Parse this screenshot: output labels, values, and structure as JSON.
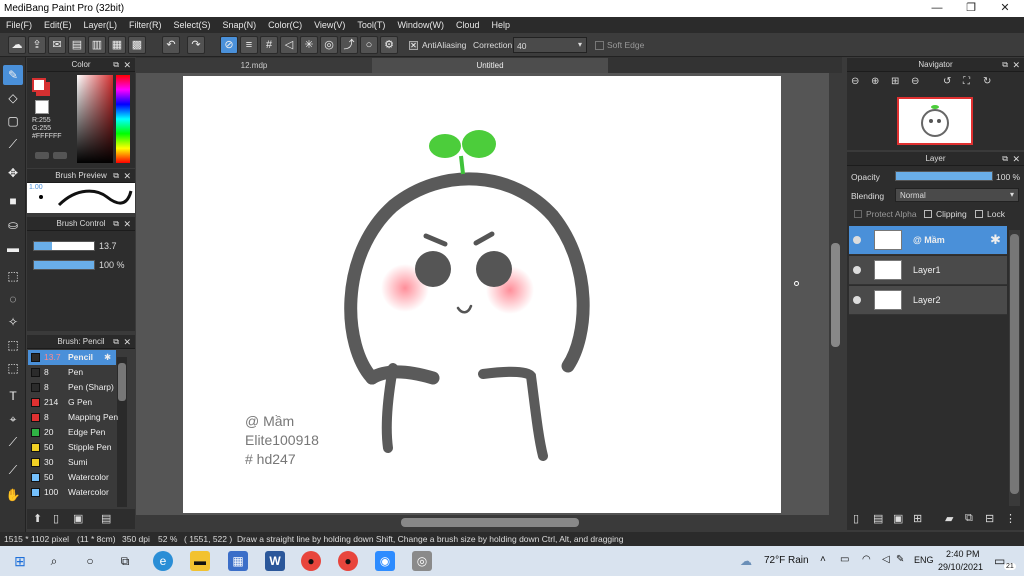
{
  "window": {
    "title": "MediBang Paint Pro (32bit)",
    "minimize": "—",
    "maximize": "❐",
    "close": "✕"
  },
  "menu": [
    "File(F)",
    "Edit(E)",
    "Layer(L)",
    "Filter(R)",
    "Select(S)",
    "Snap(N)",
    "Color(C)",
    "View(V)",
    "Tool(T)",
    "Window(W)",
    "Cloud",
    "Help"
  ],
  "toolbar": {
    "antialiasing_label": "AntiAliasing",
    "antialiasing_checked": true,
    "correction_label": "Correction",
    "correction_value": "40",
    "soft_edge_label": "Soft Edge",
    "soft_edge_checked": false
  },
  "color_panel": {
    "title": "Color",
    "r": "R:255",
    "g": "G:255",
    "b": "B:255",
    "hex": "#FFFFFF",
    "primary": "#ffffff",
    "secondary": "#d63031"
  },
  "brush_preview": {
    "title": "Brush Preview",
    "size": "1.00"
  },
  "brush_control": {
    "title": "Brush Control",
    "size_value": "13.7",
    "opacity_value": "100 %",
    "size_fill": 0.3,
    "opacity_fill": 1.0
  },
  "brush_list": {
    "title": "Brush: Pencil",
    "items": [
      {
        "size": "13.7",
        "name": "Pencil",
        "color": "#2b2b2b",
        "selected": true
      },
      {
        "size": "8",
        "name": "Pen",
        "color": "#2b2b2b"
      },
      {
        "size": "8",
        "name": "Pen (Sharp)",
        "color": "#2b2b2b"
      },
      {
        "size": "214",
        "name": "G Pen",
        "color": "#e03131"
      },
      {
        "size": "8",
        "name": "Mapping Pen",
        "color": "#e03131"
      },
      {
        "size": "20",
        "name": "Edge Pen",
        "color": "#2fb344"
      },
      {
        "size": "50",
        "name": "Stipple Pen",
        "color": "#f2d024"
      },
      {
        "size": "30",
        "name": "Sumi",
        "color": "#f2d024"
      },
      {
        "size": "50",
        "name": "Watercolor",
        "color": "#74c0fc"
      },
      {
        "size": "100",
        "name": "Watercolor",
        "color": "#74c0fc"
      }
    ]
  },
  "tabs": [
    "12.mdp",
    "Untitled"
  ],
  "artwork": {
    "line1": "@ Mầm",
    "line2": "Elite100918",
    "line3": "# hd247"
  },
  "navigator": {
    "title": "Navigator"
  },
  "layer_panel": {
    "title": "Layer",
    "opacity_label": "Opacity",
    "opacity_value": "100 %",
    "blending_label": "Blending",
    "blending_value": "Normal",
    "protect_alpha": "Protect Alpha",
    "clipping": "Clipping",
    "lock": "Lock",
    "layers": [
      {
        "name": "@ Mầm",
        "selected": true
      },
      {
        "name": "Layer1",
        "selected": false
      },
      {
        "name": "Layer2",
        "selected": false
      }
    ]
  },
  "status": {
    "size": "1515 * 1102 pixel",
    "cm": "(11 * 8cm)",
    "dpi": "350 dpi",
    "zoom": "52 %",
    "coords": "( 1551, 522 )",
    "hint": "Draw a straight line by holding down Shift, Change a brush size by holding down Ctrl, Alt, and dragging"
  },
  "taskbar": {
    "weather": "72°F  Rain",
    "lang": "ENG",
    "time": "2:40 PM",
    "date": "29/10/2021",
    "notif": "21"
  }
}
